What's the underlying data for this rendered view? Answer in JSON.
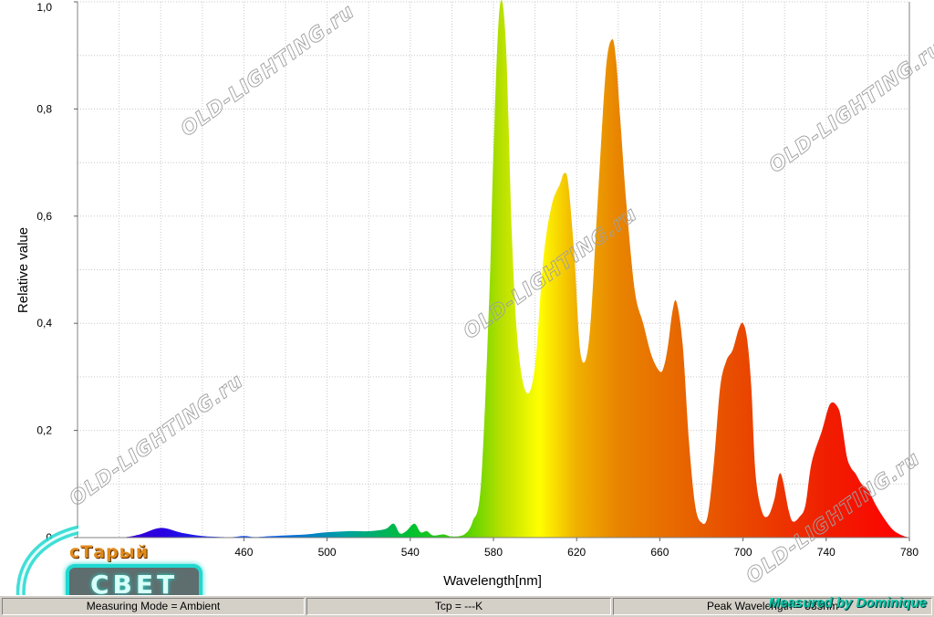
{
  "chart_data": {
    "type": "area",
    "title": "",
    "xlabel": "Wavelength[nm]",
    "ylabel": "Relative value",
    "xlim": [
      380,
      780
    ],
    "ylim": [
      0,
      1.0
    ],
    "x_ticks": [
      "460",
      "500",
      "540",
      "580",
      "620",
      "660",
      "700",
      "740",
      "780"
    ],
    "y_ticks": [
      "0",
      "0,2",
      "0,4",
      "0,6",
      "0,8",
      "1,0"
    ],
    "grid": true,
    "x": [
      380,
      400,
      410,
      420,
      430,
      440,
      450,
      455,
      460,
      465,
      470,
      480,
      490,
      500,
      510,
      520,
      528,
      532,
      535,
      538,
      542,
      545,
      548,
      551,
      556,
      560,
      566,
      570,
      574,
      578,
      580,
      583,
      586,
      589,
      592,
      596,
      600,
      604,
      608,
      612,
      614,
      616,
      619,
      622,
      626,
      630,
      634,
      637,
      639,
      641,
      644,
      648,
      652,
      656,
      660,
      662,
      664,
      666,
      668,
      671,
      674,
      677,
      680,
      683,
      686,
      689,
      692,
      695,
      698,
      700,
      702,
      704,
      706,
      709,
      712,
      715,
      718,
      722,
      724,
      727,
      730,
      733,
      738,
      742,
      746,
      748,
      750,
      752,
      754,
      757,
      760,
      764,
      768,
      772,
      776,
      780
    ],
    "values": [
      0.0,
      0.0,
      0.006,
      0.018,
      0.009,
      0.003,
      0.001,
      0.001,
      0.003,
      0.001,
      0.002,
      0.004,
      0.006,
      0.01,
      0.012,
      0.012,
      0.016,
      0.026,
      0.008,
      0.012,
      0.026,
      0.01,
      0.012,
      0.004,
      0.006,
      0.002,
      0.006,
      0.03,
      0.1,
      0.45,
      0.72,
      0.99,
      0.92,
      0.55,
      0.35,
      0.27,
      0.32,
      0.52,
      0.62,
      0.66,
      0.68,
      0.66,
      0.52,
      0.34,
      0.37,
      0.62,
      0.87,
      0.93,
      0.89,
      0.78,
      0.62,
      0.46,
      0.4,
      0.34,
      0.31,
      0.32,
      0.36,
      0.42,
      0.44,
      0.36,
      0.18,
      0.06,
      0.028,
      0.04,
      0.14,
      0.28,
      0.33,
      0.35,
      0.39,
      0.4,
      0.37,
      0.28,
      0.12,
      0.05,
      0.04,
      0.07,
      0.12,
      0.05,
      0.03,
      0.038,
      0.06,
      0.14,
      0.2,
      0.25,
      0.24,
      0.2,
      0.15,
      0.13,
      0.12,
      0.1,
      0.09,
      0.06,
      0.035,
      0.015,
      0.005,
      0.0
    ],
    "series": [
      {
        "values": "see values"
      }
    ]
  },
  "watermark_text": "OLD-LIGHTING.ru",
  "logo": {
    "top_text": "сТарый",
    "bottom_text": "СВЕТ"
  },
  "status_bar": {
    "measuring_mode": "Measuring Mode = Ambient",
    "tcp": "Tcp = ---K",
    "peak": "Peak Wavelength = 583nm"
  },
  "credit": "Measured by Dominique"
}
